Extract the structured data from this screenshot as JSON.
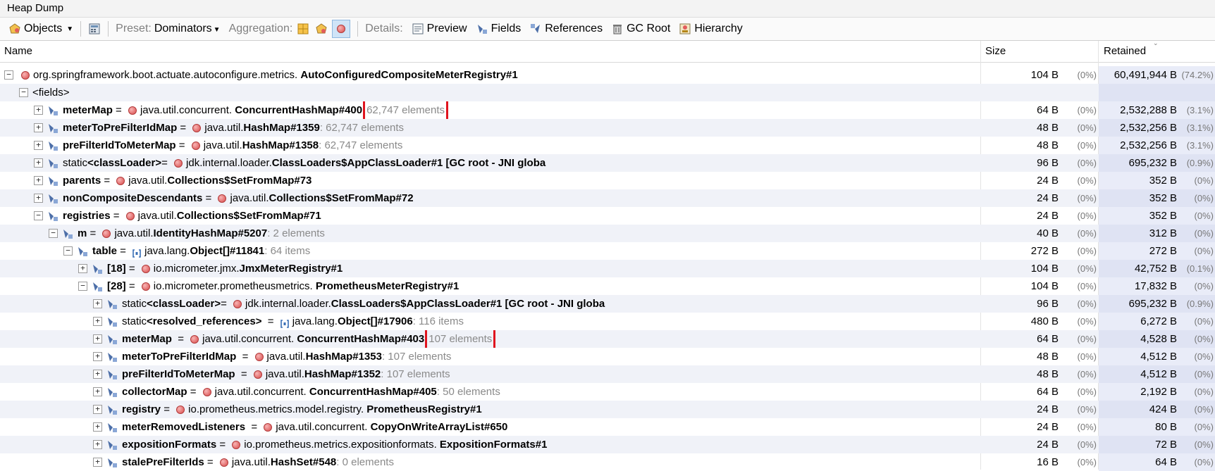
{
  "window": {
    "title": "Heap Dump"
  },
  "toolbar": {
    "objects_label": "Objects",
    "preset_label": "Preset:",
    "preset_value": "Dominators",
    "aggregation_label": "Aggregation:",
    "details_label": "Details:",
    "preview_label": "Preview",
    "fields_label": "Fields",
    "references_label": "References",
    "gcroot_label": "GC Root",
    "hierarchy_label": "Hierarchy"
  },
  "columns": {
    "name": "Name",
    "size": "Size",
    "retained": "Retained"
  },
  "rows": [
    {
      "level": 0,
      "expander": "minus",
      "kind": "root",
      "pre": "",
      "name": "",
      "eq": "",
      "pkg": "org.springframework.boot.actuate.autoconfigure.metrics. ",
      "cls": "AutoConfiguredCompositeMeterRegistry#1",
      "extra": "",
      "size": "104 B",
      "sizep": "(0%)",
      "ret": "60,491,944 B",
      "retp": "(74.2%)"
    },
    {
      "level": 1,
      "expander": "minus",
      "kind": "fields",
      "pre": "",
      "name": "<fields>",
      "eq": "",
      "pkg": "",
      "cls": "",
      "extra": "",
      "size": "",
      "sizep": "",
      "ret": "",
      "retp": ""
    },
    {
      "level": 2,
      "expander": "plus",
      "kind": "obj",
      "pre": "",
      "name": "meterMap",
      "eq": " = ",
      "pkg": "java.util.concurrent. ",
      "cls": "ConcurrentHashMap#400",
      "extra": "62,747 elements",
      "hl": true,
      "size": "64 B",
      "sizep": "(0%)",
      "ret": "2,532,288 B",
      "retp": "(3.1%)"
    },
    {
      "level": 2,
      "expander": "plus",
      "kind": "obj",
      "pre": "",
      "name": "meterToPreFilterIdMap",
      "eq": " = ",
      "pkg": "java.util.",
      "cls": "HashMap#1359",
      "extra": ": 62,747 elements",
      "size": "48 B",
      "sizep": "(0%)",
      "ret": "2,532,256 B",
      "retp": "(3.1%)"
    },
    {
      "level": 2,
      "expander": "plus",
      "kind": "obj",
      "pre": "",
      "name": "preFilterIdToMeterMap",
      "eq": " = ",
      "pkg": "java.util.",
      "cls": "HashMap#1358",
      "extra": ": 62,747 elements",
      "size": "48 B",
      "sizep": "(0%)",
      "ret": "2,532,256 B",
      "retp": "(3.1%)"
    },
    {
      "level": 2,
      "expander": "plus",
      "kind": "obj",
      "pre": "static ",
      "name": "<classLoader>",
      "eq": "= ",
      "pkg": "jdk.internal.loader.",
      "cls": "ClassLoaders$AppClassLoader#1 [GC root - JNI globa",
      "extra": "",
      "size": "96 B",
      "sizep": "(0%)",
      "ret": "695,232 B",
      "retp": "(0.9%)"
    },
    {
      "level": 2,
      "expander": "plus",
      "kind": "obj",
      "pre": "",
      "name": "parents",
      "eq": " = ",
      "pkg": "java.util.",
      "cls": "Collections$SetFromMap#73",
      "extra": "",
      "size": "24 B",
      "sizep": "(0%)",
      "ret": "352 B",
      "retp": "(0%)"
    },
    {
      "level": 2,
      "expander": "plus",
      "kind": "obj",
      "pre": "",
      "name": "nonCompositeDescendants",
      "eq": " = ",
      "pkg": "java.util.",
      "cls": "Collections$SetFromMap#72",
      "extra": "",
      "size": "24 B",
      "sizep": "(0%)",
      "ret": "352 B",
      "retp": "(0%)"
    },
    {
      "level": 2,
      "expander": "minus",
      "kind": "obj",
      "pre": "",
      "name": "registries",
      "eq": " = ",
      "pkg": "java.util.",
      "cls": "Collections$SetFromMap#71",
      "extra": "",
      "size": "24 B",
      "sizep": "(0%)",
      "ret": "352 B",
      "retp": "(0%)"
    },
    {
      "level": 3,
      "expander": "minus",
      "kind": "obj",
      "pre": "",
      "name": "m",
      "eq": " = ",
      "pkg": "java.util.",
      "cls": "IdentityHashMap#5207",
      "extra": ": 2 elements",
      "size": "40 B",
      "sizep": "(0%)",
      "ret": "312 B",
      "retp": "(0%)"
    },
    {
      "level": 4,
      "expander": "minus",
      "kind": "arr",
      "pre": "",
      "name": "table",
      "eq": " = ",
      "pkg": "java.lang.",
      "cls": "Object[]#11841",
      "extra": ": 64 items",
      "size": "272 B",
      "sizep": "(0%)",
      "ret": "272 B",
      "retp": "(0%)"
    },
    {
      "level": 5,
      "expander": "plus",
      "kind": "obj",
      "pre": "",
      "name": "[18]",
      "eq": " = ",
      "pkg": "io.micrometer.jmx.",
      "cls": "JmxMeterRegistry#1",
      "extra": "",
      "size": "104 B",
      "sizep": "(0%)",
      "ret": "42,752 B",
      "retp": "(0.1%)"
    },
    {
      "level": 5,
      "expander": "minus",
      "kind": "obj",
      "pre": "",
      "name": "[28]",
      "eq": " = ",
      "pkg": "io.micrometer.prometheusmetrics. ",
      "cls": "PrometheusMeterRegistry#1",
      "extra": "",
      "size": "104 B",
      "sizep": "(0%)",
      "ret": "17,832 B",
      "retp": "(0%)"
    },
    {
      "level": 6,
      "expander": "plus",
      "kind": "obj",
      "pre": "static ",
      "name": "<classLoader>",
      "eq": "= ",
      "pkg": "jdk.internal.loader.",
      "cls": "ClassLoaders$AppClassLoader#1 [GC root - JNI globa",
      "extra": "",
      "size": "96 B",
      "sizep": "(0%)",
      "ret": "695,232 B",
      "retp": "(0.9%)"
    },
    {
      "level": 6,
      "expander": "plus",
      "kind": "arr",
      "pre": "static ",
      "name": "<resolved_references>",
      "eq": "  = ",
      "pkg": "java.lang.",
      "cls": "Object[]#17906",
      "extra": ": 116 items",
      "size": "480 B",
      "sizep": "(0%)",
      "ret": "6,272 B",
      "retp": "(0%)"
    },
    {
      "level": 6,
      "expander": "plus",
      "kind": "obj",
      "pre": "",
      "name": "meterMap",
      "eq": "  = ",
      "pkg": "java.util.concurrent. ",
      "cls": "ConcurrentHashMap#403",
      "extra": "107 elements",
      "hl": true,
      "size": "64 B",
      "sizep": "(0%)",
      "ret": "4,528 B",
      "retp": "(0%)"
    },
    {
      "level": 6,
      "expander": "plus",
      "kind": "obj",
      "pre": "",
      "name": "meterToPreFilterIdMap",
      "eq": "  = ",
      "pkg": "java.util.",
      "cls": "HashMap#1353",
      "extra": ": 107 elements",
      "size": "48 B",
      "sizep": "(0%)",
      "ret": "4,512 B",
      "retp": "(0%)"
    },
    {
      "level": 6,
      "expander": "plus",
      "kind": "obj",
      "pre": "",
      "name": "preFilterIdToMeterMap",
      "eq": "  = ",
      "pkg": "java.util.",
      "cls": "HashMap#1352",
      "extra": ": 107 elements",
      "size": "48 B",
      "sizep": "(0%)",
      "ret": "4,512 B",
      "retp": "(0%)"
    },
    {
      "level": 6,
      "expander": "plus",
      "kind": "obj",
      "pre": "",
      "name": "collectorMap",
      "eq": " = ",
      "pkg": "java.util.concurrent. ",
      "cls": "ConcurrentHashMap#405",
      "extra": ": 50 elements",
      "size": "64 B",
      "sizep": "(0%)",
      "ret": "2,192 B",
      "retp": "(0%)"
    },
    {
      "level": 6,
      "expander": "plus",
      "kind": "obj",
      "pre": "",
      "name": "registry",
      "eq": " = ",
      "pkg": "io.prometheus.metrics.model.registry. ",
      "cls": "PrometheusRegistry#1",
      "extra": "",
      "size": "24 B",
      "sizep": "(0%)",
      "ret": "424 B",
      "retp": "(0%)"
    },
    {
      "level": 6,
      "expander": "plus",
      "kind": "obj",
      "pre": "",
      "name": "meterRemovedListeners",
      "eq": "  = ",
      "pkg": "java.util.concurrent. ",
      "cls": "CopyOnWriteArrayList#650",
      "extra": "",
      "size": "24 B",
      "sizep": "(0%)",
      "ret": "80 B",
      "retp": "(0%)"
    },
    {
      "level": 6,
      "expander": "plus",
      "kind": "obj",
      "pre": "",
      "name": "expositionFormats",
      "eq": " = ",
      "pkg": "io.prometheus.metrics.expositionformats. ",
      "cls": "ExpositionFormats#1",
      "extra": "",
      "size": "24 B",
      "sizep": "(0%)",
      "ret": "72 B",
      "retp": "(0%)"
    },
    {
      "level": 6,
      "expander": "plus",
      "kind": "obj",
      "pre": "",
      "name": "stalePreFilterIds",
      "eq": " = ",
      "pkg": "java.util.",
      "cls": "HashSet#548",
      "extra": ": 0 elements",
      "size": "16 B",
      "sizep": "(0%)",
      "ret": "64 B",
      "retp": "(0%)"
    }
  ],
  "colors": {
    "highlight": "#e0141e",
    "alt_row": "#f0f2f8",
    "retained_bg": "#e9ecf8"
  }
}
